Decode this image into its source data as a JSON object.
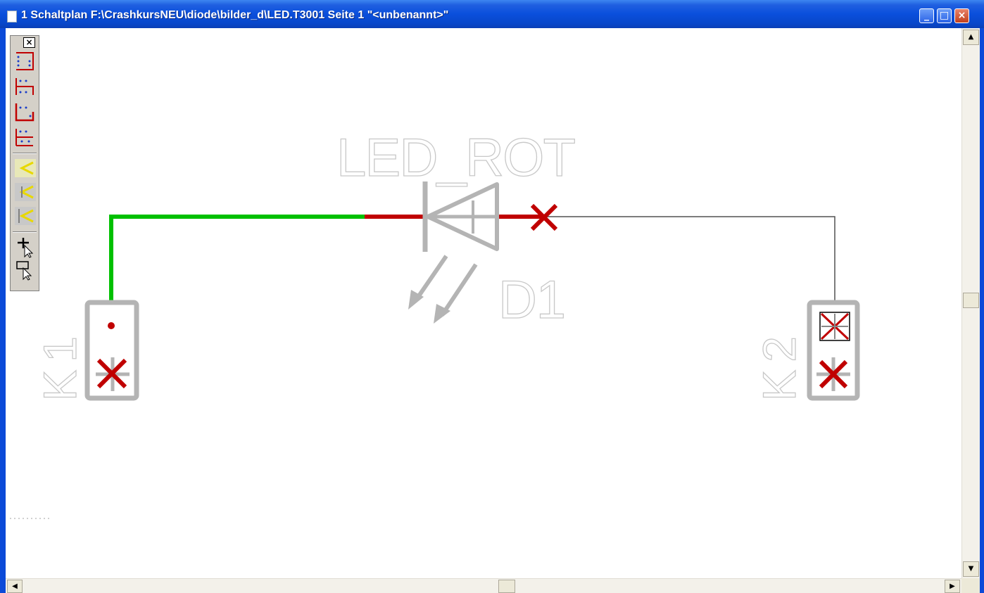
{
  "window": {
    "title": "1 Schaltplan F:\\CrashkursNEU\\diode\\bilder_d\\LED.T3001 Seite 1 \"<unbenannt>\"",
    "controls": {
      "minimize": "_",
      "maximize": "□",
      "close": "×"
    }
  },
  "toolbar": {
    "close_label": "×",
    "tools": [
      {
        "name": "bus-tool-1",
        "icon": "net-bracket-icon"
      },
      {
        "name": "bus-tool-2",
        "icon": "net-bracket-icon"
      },
      {
        "name": "bus-tool-3",
        "icon": "net-bracket-icon"
      },
      {
        "name": "bus-tool-4",
        "icon": "net-bracket-icon"
      },
      {
        "name": "junction-tool-1",
        "icon": "label-arrow-icon"
      },
      {
        "name": "junction-tool-2",
        "icon": "label-arrow-icon"
      },
      {
        "name": "junction-tool-3",
        "icon": "label-arrow-icon"
      },
      {
        "name": "crosshair-pointer-tool",
        "icon": "crosshair-cursor-icon"
      },
      {
        "name": "select-pointer-tool",
        "icon": "select-cursor-icon"
      }
    ]
  },
  "schematic": {
    "led_value": "LED_ROT",
    "led_ref": "D1",
    "connector_left_ref": "K1",
    "connector_right_ref": "K2",
    "colors": {
      "wire_routed": "#00c000",
      "wire_pin": "#c00000",
      "ratsnest": "#505050",
      "component": "#b4b4b4",
      "cross": "#c00000"
    }
  },
  "scrollbars": {
    "up": "▲",
    "down": "▼",
    "left": "◀",
    "right": "▶"
  }
}
